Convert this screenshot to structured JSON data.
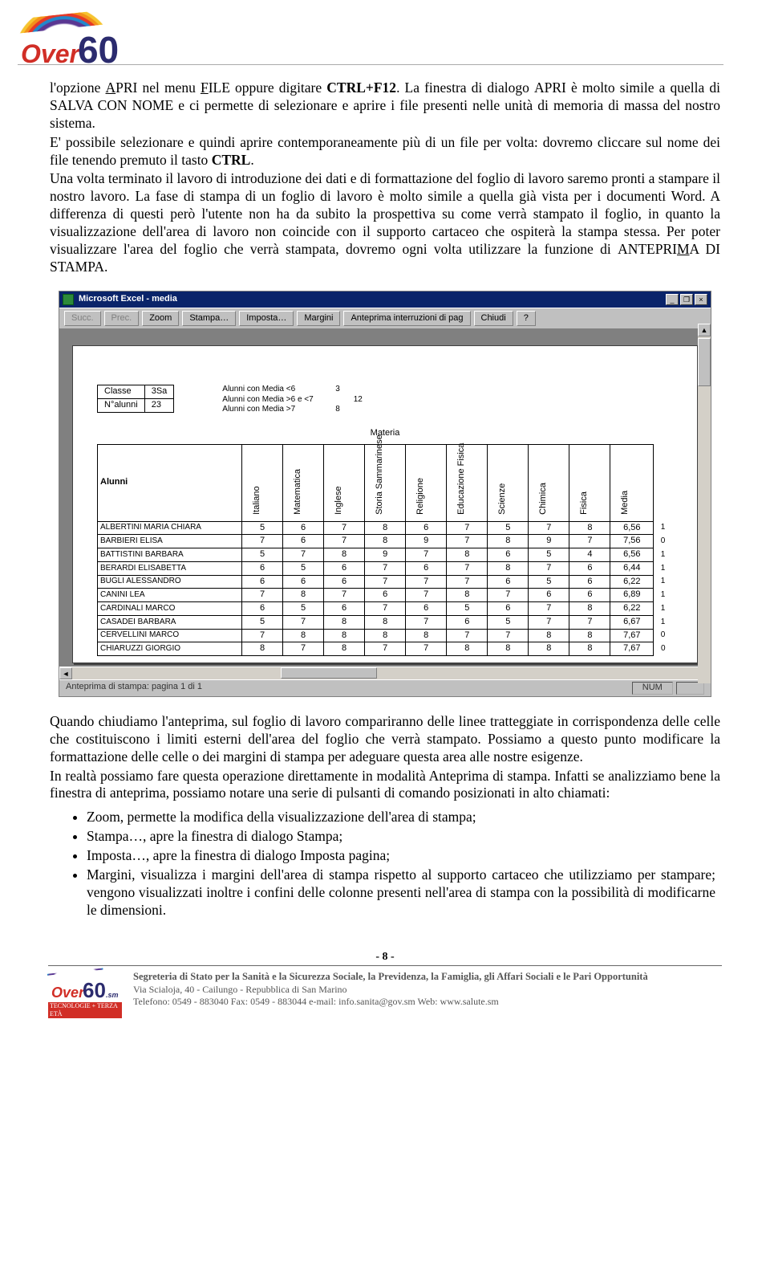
{
  "header": {
    "logo": {
      "brand": "Over",
      "num": "60"
    }
  },
  "text": {
    "p1a": "l'opzione ",
    "p1_apri": "APRI",
    "p1b": " nel menu ",
    "p1_file": "FILE",
    "p1c": " oppure digitare ",
    "p1_ctrl": "CTRL+F12",
    "p1d": ". La finestra di dialogo ",
    "p1_apri2": "APRI",
    "p1e": " è molto simile a quella di ",
    "p1_salva": "SALVA CON NOME",
    "p1f": " e ci permette di selezionare e aprire i file presenti nelle unità di memoria di massa del nostro sistema.",
    "p2a": "E' possibile selezionare e quindi aprire contemporaneamente più di un file per volta: dovremo cliccare sul nome dei file tenendo premuto il tasto ",
    "p2_ctrl": "CTRL",
    "p2b": ".",
    "p3a": "Una volta terminato il lavoro di introduzione dei dati e di formattazione del foglio di lavoro saremo pronti a stampare il nostro lavoro. La fase di stampa di un foglio di lavoro è molto simile a quella già vista per i documenti Word. A differenza di questi però l'utente non ha da subito la prospettiva su come verrà stampato il foglio, in quanto la visualizzazione dell'area di lavoro non coincide con il supporto cartaceo che ospiterà la stampa stessa. Per poter visualizzare l'area del foglio che verrà stampata, dovremo ogni volta utilizzare la funzione di ",
    "p3_ant": "ANTEPRIMA DI STAMPA",
    "p3b": ".",
    "p4": "Quando chiudiamo l'anteprima, sul foglio di lavoro compariranno delle linee tratteggiate in corrispondenza delle celle che costituiscono i limiti esterni dell'area del foglio che verrà stampato. Possiamo a questo punto modificare la formattazione delle celle o dei margini di stampa per adeguare questa area alle nostre esigenze.",
    "p5": "In realtà possiamo fare questa operazione direttamente in modalità Anteprima di stampa. Infatti se analizziamo bene la finestra di anteprima, possiamo notare una serie di pulsanti di comando posizionati in alto chiamati:"
  },
  "bullets": [
    "Zoom, permette la modifica della visualizzazione dell'area di stampa;",
    "Stampa…, apre la finestra di dialogo Stampa;",
    "Imposta…, apre la finestra di dialogo Imposta pagina;",
    "Margini, visualizza i margini dell'area di stampa rispetto al supporto cartaceo che utilizziamo per stampare; vengono visualizzati inoltre i confini delle colonne presenti nell'area di stampa con la possibilità di modificarne le dimensioni."
  ],
  "excel": {
    "title": "Microsoft Excel - media",
    "toolbar": [
      "Succ.",
      "Prec.",
      "Zoom",
      "Stampa…",
      "Imposta…",
      "Margini",
      "Anteprima interruzioni di pag",
      "Chiudi",
      "?"
    ],
    "toolbar_disabled": [
      0,
      1
    ],
    "info": {
      "classe_label": "Classe",
      "classe_val": "3Sa",
      "nalunni_label": "N°alunni",
      "nalunni_val": "23"
    },
    "stats": [
      {
        "label": "Alunni con Media <6",
        "val": "3"
      },
      {
        "label": "Alunni con Media >6 e <7",
        "val": "12"
      },
      {
        "label": "Alunni con Media >7",
        "val": "8"
      }
    ],
    "materia_header": "Materia",
    "columns": [
      "Italiano",
      "Matematica",
      "Inglese",
      "Storia Sammarinese",
      "Religione",
      "Educazione Fisica",
      "Scienze",
      "Chimica",
      "Fisica",
      "Media"
    ],
    "alunni_header": "Alunni",
    "rows": [
      {
        "name": "ALBERTINI MARIA CHIARA",
        "v": [
          "5",
          "6",
          "7",
          "8",
          "6",
          "7",
          "5",
          "7",
          "8",
          "6,56"
        ],
        "t": "1"
      },
      {
        "name": "BARBIERI ELISA",
        "v": [
          "7",
          "6",
          "7",
          "8",
          "9",
          "7",
          "8",
          "9",
          "7",
          "7,56"
        ],
        "t": "0"
      },
      {
        "name": "BATTISTINI BARBARA",
        "v": [
          "5",
          "7",
          "8",
          "9",
          "7",
          "8",
          "6",
          "5",
          "4",
          "6,56"
        ],
        "t": "1"
      },
      {
        "name": "BERARDI ELISABETTA",
        "v": [
          "6",
          "5",
          "6",
          "7",
          "6",
          "7",
          "8",
          "7",
          "6",
          "6,44"
        ],
        "t": "1"
      },
      {
        "name": "BUGLI ALESSANDRO",
        "v": [
          "6",
          "6",
          "6",
          "7",
          "7",
          "7",
          "6",
          "5",
          "6",
          "6,22"
        ],
        "t": "1"
      },
      {
        "name": "CANINI LEA",
        "v": [
          "7",
          "8",
          "7",
          "6",
          "7",
          "8",
          "7",
          "6",
          "6",
          "6,89"
        ],
        "t": "1"
      },
      {
        "name": "CARDINALI MARCO",
        "v": [
          "6",
          "5",
          "6",
          "7",
          "6",
          "5",
          "6",
          "7",
          "8",
          "6,22"
        ],
        "t": "1"
      },
      {
        "name": "CASADEI BARBARA",
        "v": [
          "5",
          "7",
          "8",
          "8",
          "7",
          "6",
          "5",
          "7",
          "7",
          "6,67"
        ],
        "t": "1"
      },
      {
        "name": "CERVELLINI MARCO",
        "v": [
          "7",
          "8",
          "8",
          "8",
          "8",
          "7",
          "7",
          "8",
          "8",
          "7,67"
        ],
        "t": "0"
      },
      {
        "name": "CHIARUZZI GIORGIO",
        "v": [
          "8",
          "7",
          "8",
          "7",
          "7",
          "8",
          "8",
          "8",
          "8",
          "7,67"
        ],
        "t": "0"
      }
    ],
    "status_left": "Anteprima di stampa: pagina 1 di 1",
    "status_num": "NUM"
  },
  "footer": {
    "pagenum": "- 8 -",
    "logo": {
      "brand": "Over",
      "num": "60",
      "sm": ".sm",
      "tag": "TECNOLOGIE + TERZA ETÀ"
    },
    "l1": "Segreteria di Stato per la Sanità e la Sicurezza Sociale, la Previdenza, la Famiglia, gli Affari Sociali e le Pari Opportunità",
    "l2": "Via Scialoja, 40 - Cailungo - Repubblica di San Marino",
    "l3": "Telefono: 0549 - 883040 Fax: 0549 - 883044 e-mail: info.sanita@gov.sm Web: www.salute.sm"
  }
}
